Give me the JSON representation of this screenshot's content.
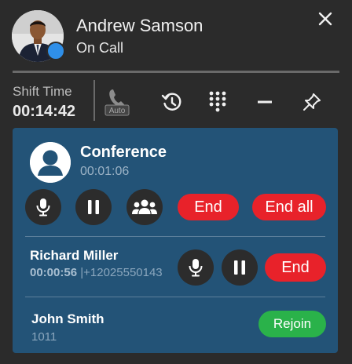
{
  "header": {
    "name": "Andrew Samson",
    "status": "On Call",
    "presence_color": "#2f8fe8",
    "close_icon": "close-icon"
  },
  "toolbar": {
    "shift_label": "Shift Time",
    "shift_time": "00:14:42",
    "auto_label": "Auto",
    "tools": [
      "auto-answer-icon",
      "history-icon",
      "dialpad-icon",
      "minimize-icon",
      "pin-icon"
    ]
  },
  "conference": {
    "title": "Conference",
    "duration": "00:01:06",
    "end_label": "End",
    "end_all_label": "End all"
  },
  "participants": [
    {
      "name": "Richard Miller",
      "duration": "00:00:56",
      "separator": "|",
      "number": "+12025550143",
      "action": "End"
    },
    {
      "name": "John Smith",
      "extension": "1011",
      "action": "Rejoin"
    }
  ],
  "colors": {
    "panel": "#235377",
    "end": "#e8222a",
    "rejoin": "#2ab24a",
    "background": "#2b2b2b"
  }
}
